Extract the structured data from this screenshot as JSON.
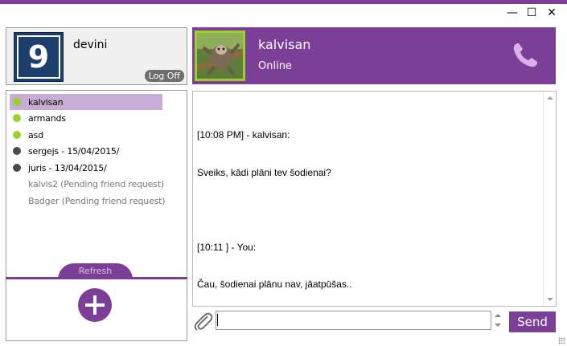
{
  "window": {
    "minimize_glyph": "—",
    "maximize_glyph": "☐",
    "close_glyph": "✕",
    "accent_color": "#7b3f98"
  },
  "user": {
    "avatar_text": "9",
    "name": "devini",
    "logoff_label": "Log Off"
  },
  "contacts": [
    {
      "label": "kalvisan",
      "status": "online",
      "selected": true
    },
    {
      "label": "armands",
      "status": "online",
      "selected": false
    },
    {
      "label": "asd",
      "status": "online",
      "selected": false
    },
    {
      "label": "sergejs - 15/04/2015/",
      "status": "offline",
      "selected": false
    },
    {
      "label": "juris - 13/04/2015/",
      "status": "offline",
      "selected": false
    },
    {
      "label": "kalvis2 (Pending friend request)",
      "status": "pending",
      "selected": false
    },
    {
      "label": "Badger (Pending friend request)",
      "status": "pending",
      "selected": false
    }
  ],
  "refresh_label": "Refresh",
  "add_contact_icon": "plus-icon",
  "chat": {
    "peer_name": "kalvisan",
    "peer_status": "Online",
    "call_icon": "phone-icon",
    "messages": [
      {
        "header": "[10:08 PM] - kalvisan:",
        "text": "Sveiks, kādi plāni tev šodienai?"
      },
      {
        "header": "[10:11 ] - You:",
        "text": "Čau, šodienai plānu nav, jāatpūšas.."
      }
    ]
  },
  "composer": {
    "attach_icon": "paperclip-icon",
    "value": "",
    "send_label": "Send"
  }
}
